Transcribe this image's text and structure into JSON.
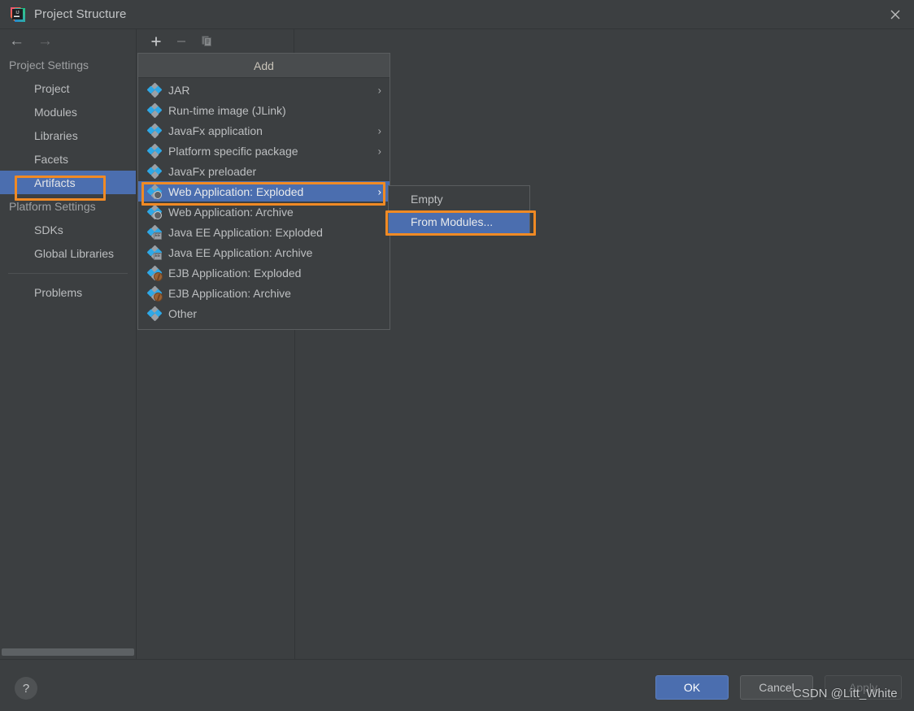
{
  "window": {
    "title": "Project Structure",
    "app_icon": "intellij-idea-logo",
    "close_icon": "✕"
  },
  "nav": {
    "back_icon": "←",
    "forward_icon": "→"
  },
  "toolbar": {
    "add_icon": "+",
    "remove_icon": "−",
    "copy_icon": "copy-icon"
  },
  "sidebar": {
    "groups": [
      {
        "label": "Project Settings",
        "items": [
          {
            "label": "Project",
            "selected": false
          },
          {
            "label": "Modules",
            "selected": false
          },
          {
            "label": "Libraries",
            "selected": false
          },
          {
            "label": "Facets",
            "selected": false
          },
          {
            "label": "Artifacts",
            "selected": true
          }
        ]
      },
      {
        "label": "Platform Settings",
        "items": [
          {
            "label": "SDKs",
            "selected": false
          },
          {
            "label": "Global Libraries",
            "selected": false
          }
        ]
      }
    ],
    "problems_label": "Problems"
  },
  "popup": {
    "header": "Add",
    "items": [
      {
        "label": "JAR",
        "icon": "artifact-diamond-icon",
        "submenu": true
      },
      {
        "label": "Run-time image (JLink)",
        "icon": "artifact-diamond-icon",
        "submenu": false
      },
      {
        "label": "JavaFx application",
        "icon": "artifact-diamond-icon",
        "submenu": true
      },
      {
        "label": "Platform specific package",
        "icon": "artifact-diamond-icon",
        "submenu": true
      },
      {
        "label": "JavaFx preloader",
        "icon": "artifact-diamond-icon",
        "submenu": false
      },
      {
        "label": "Web Application: Exploded",
        "icon": "web-artifact-icon",
        "submenu": true,
        "highlighted": true
      },
      {
        "label": "Web Application: Archive",
        "icon": "web-artifact-icon",
        "submenu": false
      },
      {
        "label": "Java EE Application: Exploded",
        "icon": "javaee-artifact-icon",
        "submenu": false
      },
      {
        "label": "Java EE Application: Archive",
        "icon": "javaee-artifact-icon",
        "submenu": false
      },
      {
        "label": "EJB Application: Exploded",
        "icon": "ejb-artifact-icon",
        "submenu": false
      },
      {
        "label": "EJB Application: Archive",
        "icon": "ejb-artifact-icon",
        "submenu": false
      },
      {
        "label": "Other",
        "icon": "artifact-diamond-icon",
        "submenu": false
      }
    ]
  },
  "submenu": {
    "items": [
      {
        "label": "Empty",
        "highlighted": false
      },
      {
        "label": "From Modules...",
        "highlighted": true
      }
    ]
  },
  "footer": {
    "help_label": "?",
    "ok_label": "OK",
    "cancel_label": "Cancel",
    "apply_label": "Apply"
  },
  "watermark": {
    "text": "CSDN @Litt_White"
  },
  "colors": {
    "window_bg": "#3c3f41",
    "selection_blue": "#4b6eaf",
    "annotation_orange": "#f08a24",
    "icon_blue": "#2fa8e6",
    "icon_gray": "#9aa0a6"
  }
}
